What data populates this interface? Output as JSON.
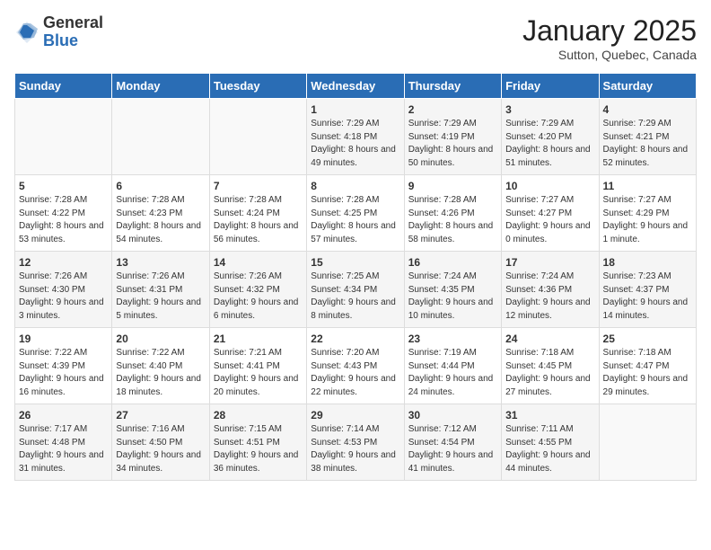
{
  "header": {
    "logo_general": "General",
    "logo_blue": "Blue",
    "month": "January 2025",
    "location": "Sutton, Quebec, Canada"
  },
  "weekdays": [
    "Sunday",
    "Monday",
    "Tuesday",
    "Wednesday",
    "Thursday",
    "Friday",
    "Saturday"
  ],
  "weeks": [
    [
      {
        "day": "",
        "info": ""
      },
      {
        "day": "",
        "info": ""
      },
      {
        "day": "",
        "info": ""
      },
      {
        "day": "1",
        "info": "Sunrise: 7:29 AM\nSunset: 4:18 PM\nDaylight: 8 hours and 49 minutes."
      },
      {
        "day": "2",
        "info": "Sunrise: 7:29 AM\nSunset: 4:19 PM\nDaylight: 8 hours and 50 minutes."
      },
      {
        "day": "3",
        "info": "Sunrise: 7:29 AM\nSunset: 4:20 PM\nDaylight: 8 hours and 51 minutes."
      },
      {
        "day": "4",
        "info": "Sunrise: 7:29 AM\nSunset: 4:21 PM\nDaylight: 8 hours and 52 minutes."
      }
    ],
    [
      {
        "day": "5",
        "info": "Sunrise: 7:28 AM\nSunset: 4:22 PM\nDaylight: 8 hours and 53 minutes."
      },
      {
        "day": "6",
        "info": "Sunrise: 7:28 AM\nSunset: 4:23 PM\nDaylight: 8 hours and 54 minutes."
      },
      {
        "day": "7",
        "info": "Sunrise: 7:28 AM\nSunset: 4:24 PM\nDaylight: 8 hours and 56 minutes."
      },
      {
        "day": "8",
        "info": "Sunrise: 7:28 AM\nSunset: 4:25 PM\nDaylight: 8 hours and 57 minutes."
      },
      {
        "day": "9",
        "info": "Sunrise: 7:28 AM\nSunset: 4:26 PM\nDaylight: 8 hours and 58 minutes."
      },
      {
        "day": "10",
        "info": "Sunrise: 7:27 AM\nSunset: 4:27 PM\nDaylight: 9 hours and 0 minutes."
      },
      {
        "day": "11",
        "info": "Sunrise: 7:27 AM\nSunset: 4:29 PM\nDaylight: 9 hours and 1 minute."
      }
    ],
    [
      {
        "day": "12",
        "info": "Sunrise: 7:26 AM\nSunset: 4:30 PM\nDaylight: 9 hours and 3 minutes."
      },
      {
        "day": "13",
        "info": "Sunrise: 7:26 AM\nSunset: 4:31 PM\nDaylight: 9 hours and 5 minutes."
      },
      {
        "day": "14",
        "info": "Sunrise: 7:26 AM\nSunset: 4:32 PM\nDaylight: 9 hours and 6 minutes."
      },
      {
        "day": "15",
        "info": "Sunrise: 7:25 AM\nSunset: 4:34 PM\nDaylight: 9 hours and 8 minutes."
      },
      {
        "day": "16",
        "info": "Sunrise: 7:24 AM\nSunset: 4:35 PM\nDaylight: 9 hours and 10 minutes."
      },
      {
        "day": "17",
        "info": "Sunrise: 7:24 AM\nSunset: 4:36 PM\nDaylight: 9 hours and 12 minutes."
      },
      {
        "day": "18",
        "info": "Sunrise: 7:23 AM\nSunset: 4:37 PM\nDaylight: 9 hours and 14 minutes."
      }
    ],
    [
      {
        "day": "19",
        "info": "Sunrise: 7:22 AM\nSunset: 4:39 PM\nDaylight: 9 hours and 16 minutes."
      },
      {
        "day": "20",
        "info": "Sunrise: 7:22 AM\nSunset: 4:40 PM\nDaylight: 9 hours and 18 minutes."
      },
      {
        "day": "21",
        "info": "Sunrise: 7:21 AM\nSunset: 4:41 PM\nDaylight: 9 hours and 20 minutes."
      },
      {
        "day": "22",
        "info": "Sunrise: 7:20 AM\nSunset: 4:43 PM\nDaylight: 9 hours and 22 minutes."
      },
      {
        "day": "23",
        "info": "Sunrise: 7:19 AM\nSunset: 4:44 PM\nDaylight: 9 hours and 24 minutes."
      },
      {
        "day": "24",
        "info": "Sunrise: 7:18 AM\nSunset: 4:45 PM\nDaylight: 9 hours and 27 minutes."
      },
      {
        "day": "25",
        "info": "Sunrise: 7:18 AM\nSunset: 4:47 PM\nDaylight: 9 hours and 29 minutes."
      }
    ],
    [
      {
        "day": "26",
        "info": "Sunrise: 7:17 AM\nSunset: 4:48 PM\nDaylight: 9 hours and 31 minutes."
      },
      {
        "day": "27",
        "info": "Sunrise: 7:16 AM\nSunset: 4:50 PM\nDaylight: 9 hours and 34 minutes."
      },
      {
        "day": "28",
        "info": "Sunrise: 7:15 AM\nSunset: 4:51 PM\nDaylight: 9 hours and 36 minutes."
      },
      {
        "day": "29",
        "info": "Sunrise: 7:14 AM\nSunset: 4:53 PM\nDaylight: 9 hours and 38 minutes."
      },
      {
        "day": "30",
        "info": "Sunrise: 7:12 AM\nSunset: 4:54 PM\nDaylight: 9 hours and 41 minutes."
      },
      {
        "day": "31",
        "info": "Sunrise: 7:11 AM\nSunset: 4:55 PM\nDaylight: 9 hours and 44 minutes."
      },
      {
        "day": "",
        "info": ""
      }
    ]
  ]
}
